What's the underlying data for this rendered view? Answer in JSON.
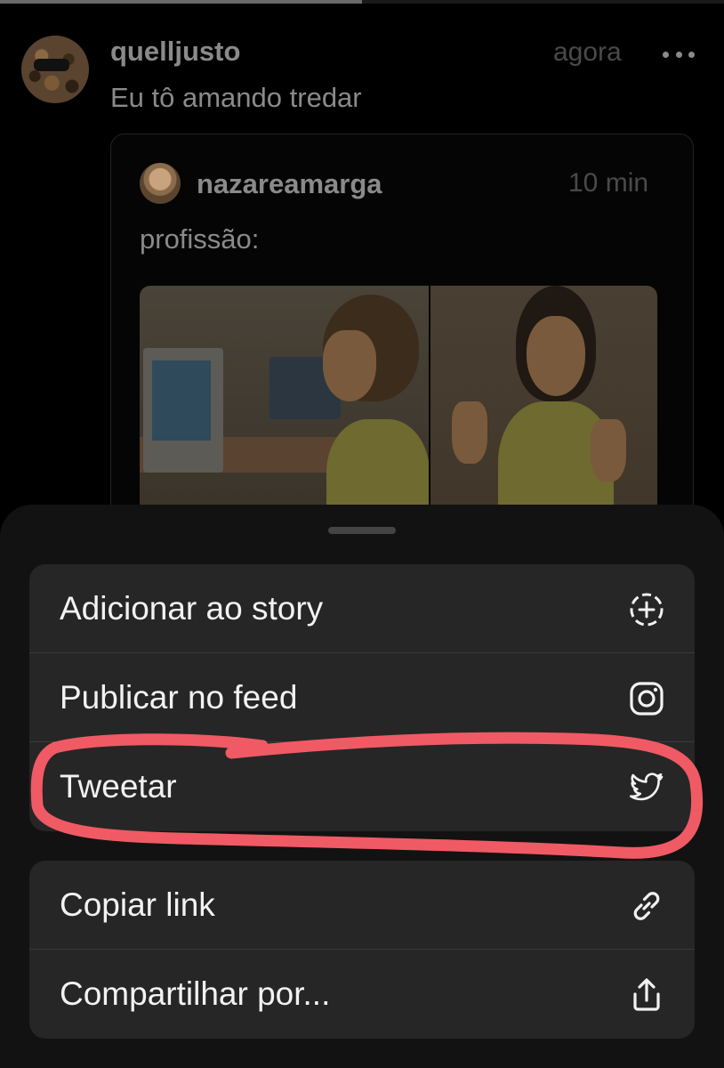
{
  "top_progress": {
    "fraction": 0.5
  },
  "post": {
    "username": "quelljusto",
    "timestamp": "agora",
    "text": "Eu tô amando tredar",
    "quote": {
      "username": "nazareamarga",
      "timestamp": "10 min",
      "text": "profissão:"
    }
  },
  "sheet": {
    "group1": [
      {
        "label": "Adicionar ao story",
        "icon": "add-story-icon"
      },
      {
        "label": "Publicar no feed",
        "icon": "instagram-icon"
      },
      {
        "label": "Tweetar",
        "icon": "twitter-icon"
      }
    ],
    "group2": [
      {
        "label": "Copiar link",
        "icon": "link-icon"
      },
      {
        "label": "Compartilhar por...",
        "icon": "share-icon"
      }
    ]
  },
  "colors": {
    "highlight": "#f05a64",
    "sheet_bg": "#121212",
    "group_bg": "#262626"
  }
}
